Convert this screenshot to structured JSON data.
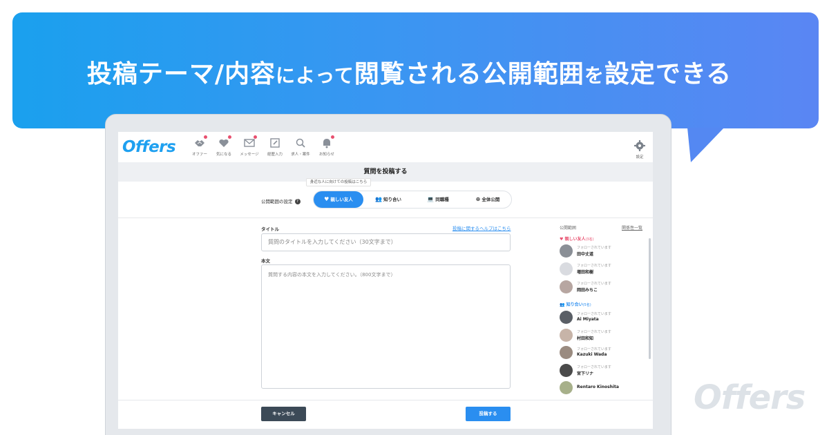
{
  "headline": {
    "part1": "投稿テーマ/内容",
    "part2": "によって",
    "part3": "閲覧される公開範囲",
    "part4": "を",
    "part5": "設定できる"
  },
  "nav": {
    "logo": "Offers",
    "items": [
      {
        "label": "オファー",
        "icon": "handshake-icon",
        "badge": true
      },
      {
        "label": "気になる",
        "icon": "heart-icon",
        "badge": true
      },
      {
        "label": "メッセージ",
        "icon": "mail-icon",
        "badge": true
      },
      {
        "label": "経歴入力",
        "icon": "edit-icon",
        "badge": false
      },
      {
        "label": "求人・案件",
        "icon": "search-icon",
        "badge": false
      },
      {
        "label": "お知らせ",
        "icon": "bell-icon",
        "badge": true
      }
    ],
    "settings_label": "設定"
  },
  "page_title": "質問を投稿する",
  "tooltip": "身近な人に向けての投稿はこちら",
  "scope": {
    "label": "公開範囲の設定",
    "options": [
      {
        "label": "親しい友人",
        "icon": "heart-icon",
        "active": true
      },
      {
        "label": "知り合い",
        "icon": "people-icon",
        "active": false
      },
      {
        "label": "同職種",
        "icon": "laptop-icon",
        "active": false
      },
      {
        "label": "全体公開",
        "icon": "globe-icon",
        "active": false
      }
    ]
  },
  "form": {
    "title_label": "タイトル",
    "help_link": "投稿に関するヘルプはこちら",
    "title_placeholder": "質問のタイトルを入力してください（30文字まで）",
    "body_label": "本文",
    "body_placeholder": "質問する内容の本文を入力してください。（800文字まで）",
    "cancel": "キャンセル",
    "submit": "投稿する"
  },
  "panel": {
    "title": "公開範囲",
    "link": "関係性一覧",
    "groups": [
      {
        "name": "親しい友人",
        "count": "(3名)",
        "color": "#e8506f",
        "members": [
          {
            "follow": "フォローされています",
            "name": "田中丈道",
            "color": "#8a8f96"
          },
          {
            "follow": "フォローされています",
            "name": "増田和樹",
            "color": "#d9dbe0"
          },
          {
            "follow": "フォローされています",
            "name": "岡田みちこ",
            "color": "#b7a6a1"
          }
        ]
      },
      {
        "name": "知り合い",
        "count": "(5名)",
        "color": "#2a8ef0",
        "members": [
          {
            "follow": "フォローされています",
            "name": "Ai Miyata",
            "color": "#5a5f66"
          },
          {
            "follow": "フォローされています",
            "name": "村田和知",
            "color": "#c7b4a8"
          },
          {
            "follow": "フォローされています",
            "name": "Kazuki Wada",
            "color": "#9a8b80"
          },
          {
            "follow": "フォローされています",
            "name": "宮下リナ",
            "color": "#4a4a4a"
          },
          {
            "follow": "",
            "name": "Rentaro Kinoshita",
            "color": "#a7b08a"
          }
        ]
      }
    ]
  },
  "watermark": "Offers"
}
